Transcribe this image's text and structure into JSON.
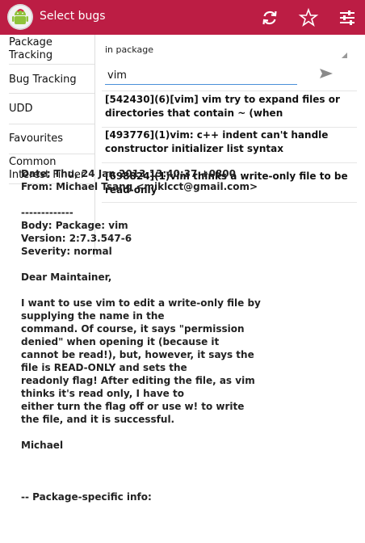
{
  "actionbar": {
    "title": "Select bugs",
    "icons": [
      "android-app-icon",
      "refresh-icon",
      "star-icon",
      "settings-sliders-icon"
    ],
    "bg_color": "#bc1d44"
  },
  "sidebar": {
    "items": [
      {
        "label": "Package Tracking"
      },
      {
        "label": "Bug Tracking"
      },
      {
        "label": "UDD"
      },
      {
        "label": "Favourites"
      },
      {
        "label": "Common Interest Finder"
      }
    ]
  },
  "search": {
    "scope": "in package",
    "query": "vim"
  },
  "bugs": [
    {
      "text": "[542430](6)[vim] vim try to expand files or directories that contain ~ (when"
    },
    {
      "text": "[493776](1)vim: c++ indent can't handle constructor initializer list syntax"
    },
    {
      "text": "[698824](1)vim thinks a write-only file to be read-only"
    }
  ],
  "detail": {
    "body": "Date: Thu, 24 Jan 2013 13:40:37 +0800\nFrom: Michael Tsang <miklcct@gmail.com>\n\n-------------\nBody: Package: vim\nVersion: 2:7.3.547-6\nSeverity: normal\n\nDear Maintainer,\n\nI want to use vim to edit a write-only file by supplying the name in the\ncommand. Of course, it says \"permission denied\" when opening it (because it\ncannot be read!), but, however, it says the file is READ-ONLY and sets the\nreadonly flag! After editing the file, as vim thinks it's read only, I have to\neither turn the flag off or use w! to write the file, and it is successful.\n\nMichael\n\n\n\n-- Package-specific info:"
  }
}
